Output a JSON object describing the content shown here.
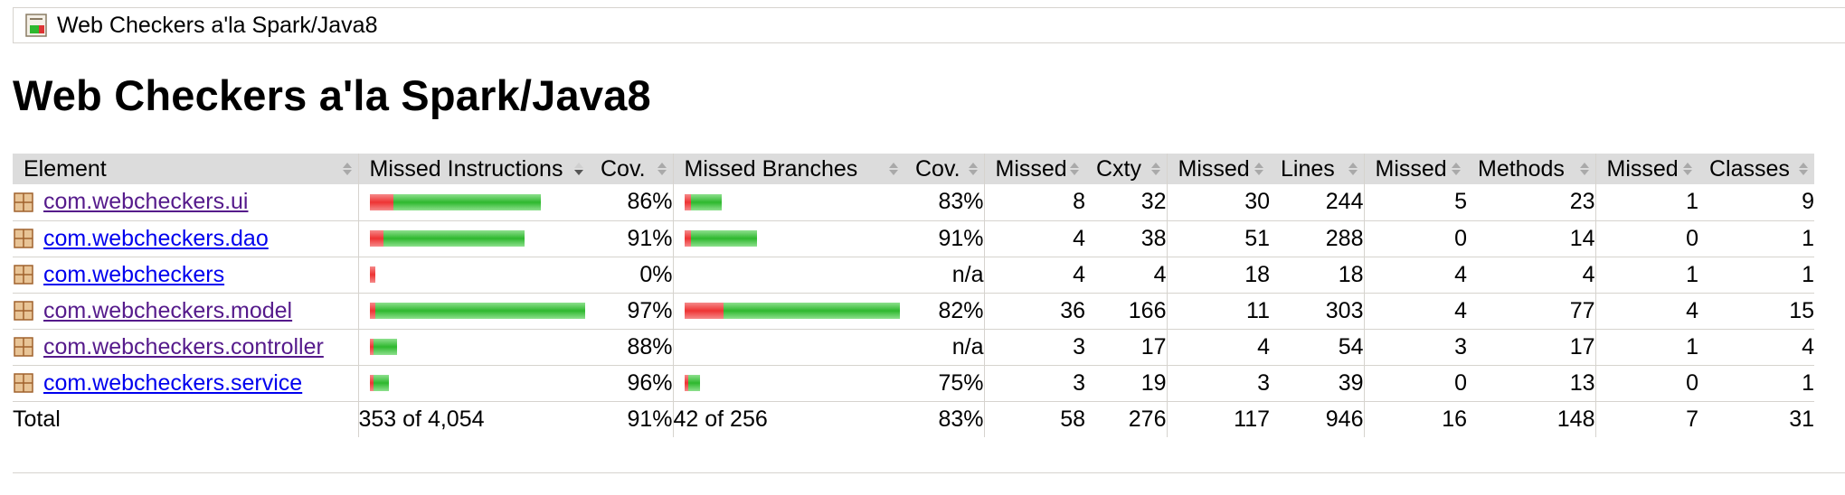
{
  "breadcrumb": {
    "label": "Web Checkers a'la Spark/Java8"
  },
  "page_title": "Web Checkers a'la Spark/Java8",
  "colors": {
    "missed_bar": "#e33333",
    "covered_bar": "#2eb82e",
    "header_bg": "#dcdcdc"
  },
  "table": {
    "headers": {
      "element": "Element",
      "missed_instructions": "Missed Instructions",
      "cov_instructions": "Cov.",
      "missed_branches": "Missed Branches",
      "cov_branches": "Cov.",
      "missed_cxty": "Missed",
      "cxty": "Cxty",
      "missed_lines": "Missed",
      "lines": "Lines",
      "missed_methods": "Missed",
      "methods": "Methods",
      "missed_classes": "Missed",
      "classes": "Classes"
    },
    "rows": [
      {
        "name": "com.webcheckers.ui",
        "visited": true,
        "instr_missed": 165,
        "instr_covered": 1030,
        "instr_cov": "86%",
        "br_missed": 5,
        "br_covered": 24,
        "br_cov": "83%",
        "missed_cxty": "8",
        "cxty": "32",
        "missed_lines": "30",
        "lines": "244",
        "missed_methods": "5",
        "methods": "23",
        "missed_classes": "1",
        "classes": "9"
      },
      {
        "name": "com.webcheckers.dao",
        "visited": false,
        "instr_missed": 95,
        "instr_covered": 985,
        "instr_cov": "91%",
        "br_missed": 5,
        "br_covered": 51,
        "br_cov": "91%",
        "missed_cxty": "4",
        "cxty": "38",
        "missed_lines": "51",
        "lines": "288",
        "missed_methods": "0",
        "methods": "14",
        "missed_classes": "0",
        "classes": "1"
      },
      {
        "name": "com.webcheckers",
        "visited": false,
        "instr_missed": 38,
        "instr_covered": 0,
        "instr_cov": "0%",
        "br_missed": 0,
        "br_covered": 0,
        "br_cov": "n/a",
        "missed_cxty": "4",
        "cxty": "4",
        "missed_lines": "18",
        "lines": "18",
        "missed_methods": "4",
        "methods": "4",
        "missed_classes": "1",
        "classes": "1"
      },
      {
        "name": "com.webcheckers.model",
        "visited": true,
        "instr_missed": 40,
        "instr_covered": 1460,
        "instr_cov": "97%",
        "br_missed": 30,
        "br_covered": 137,
        "br_cov": "82%",
        "missed_cxty": "36",
        "cxty": "166",
        "missed_lines": "11",
        "lines": "303",
        "missed_methods": "4",
        "methods": "77",
        "missed_classes": "4",
        "classes": "15"
      },
      {
        "name": "com.webcheckers.controller",
        "visited": true,
        "instr_missed": 6,
        "instr_covered": 162,
        "instr_cov": "88%",
        "br_missed": 0,
        "br_covered": 0,
        "br_cov": "n/a",
        "missed_cxty": "3",
        "cxty": "17",
        "missed_lines": "4",
        "lines": "54",
        "missed_methods": "3",
        "methods": "17",
        "missed_classes": "1",
        "classes": "4"
      },
      {
        "name": "com.webcheckers.service",
        "visited": false,
        "instr_missed": 4,
        "instr_covered": 105,
        "instr_cov": "96%",
        "br_missed": 3,
        "br_covered": 9,
        "br_cov": "75%",
        "missed_cxty": "3",
        "cxty": "19",
        "missed_lines": "3",
        "lines": "39",
        "missed_methods": "0",
        "methods": "13",
        "missed_classes": "0",
        "classes": "1"
      }
    ],
    "total": {
      "label": "Total",
      "missed_instructions": "353 of 4,054",
      "instr_cov": "91%",
      "missed_branches": "42 of 256",
      "br_cov": "83%",
      "missed_cxty": "58",
      "cxty": "276",
      "missed_lines": "117",
      "lines": "946",
      "missed_methods": "16",
      "methods": "148",
      "missed_classes": "7",
      "classes": "31"
    }
  }
}
